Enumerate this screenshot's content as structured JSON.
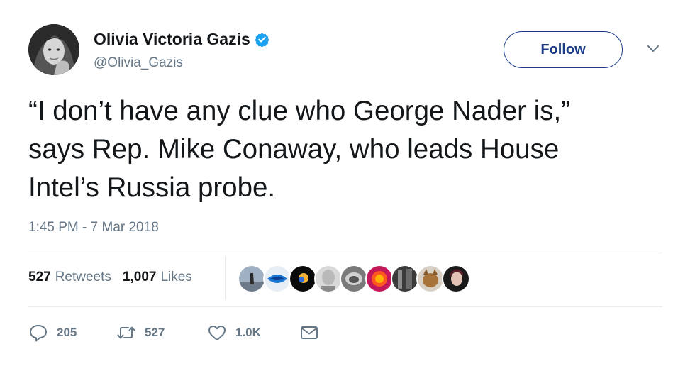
{
  "author": {
    "display_name": "Olivia Victoria Gazis",
    "handle": "@Olivia_Gazis",
    "verified": true,
    "verified_icon": "verified-badge-icon",
    "verified_color": "#1da1f2"
  },
  "follow_button": {
    "label": "Follow",
    "color": "#1b3b88"
  },
  "tweet": {
    "text_lines": [
      "“I don’t have any clue who George Nader is,”",
      "says Rep. Mike Conaway, who leads House",
      "Intel’s Russia probe."
    ],
    "timestamp": "1:45 PM - 7 Mar 2018"
  },
  "stats": {
    "retweets_count": "527",
    "retweets_label": "Retweets",
    "likes_count": "1,007",
    "likes_label": "Likes"
  },
  "likers_avatars": 9,
  "actions": {
    "reply_count": "205",
    "retweet_count": "527",
    "like_count": "1.0K",
    "reply_icon": "reply-icon",
    "retweet_icon": "retweet-icon",
    "like_icon": "heart-icon",
    "dm_icon": "envelope-icon",
    "icon_color": "#657786"
  }
}
